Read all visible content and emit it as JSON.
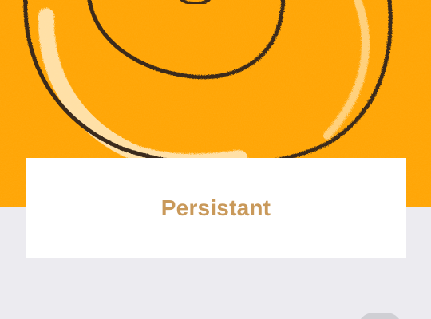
{
  "card": {
    "title": "Persistant"
  },
  "colors": {
    "hero_background": "#ffa300",
    "page_background": "#ecebf0",
    "card_background": "#ffffff",
    "title_color": "#c9995a",
    "spiral_stroke": "#3b2a1a",
    "chalk_highlight": "#fff4dc"
  },
  "icons": {
    "hero": "spiral-illustration"
  }
}
